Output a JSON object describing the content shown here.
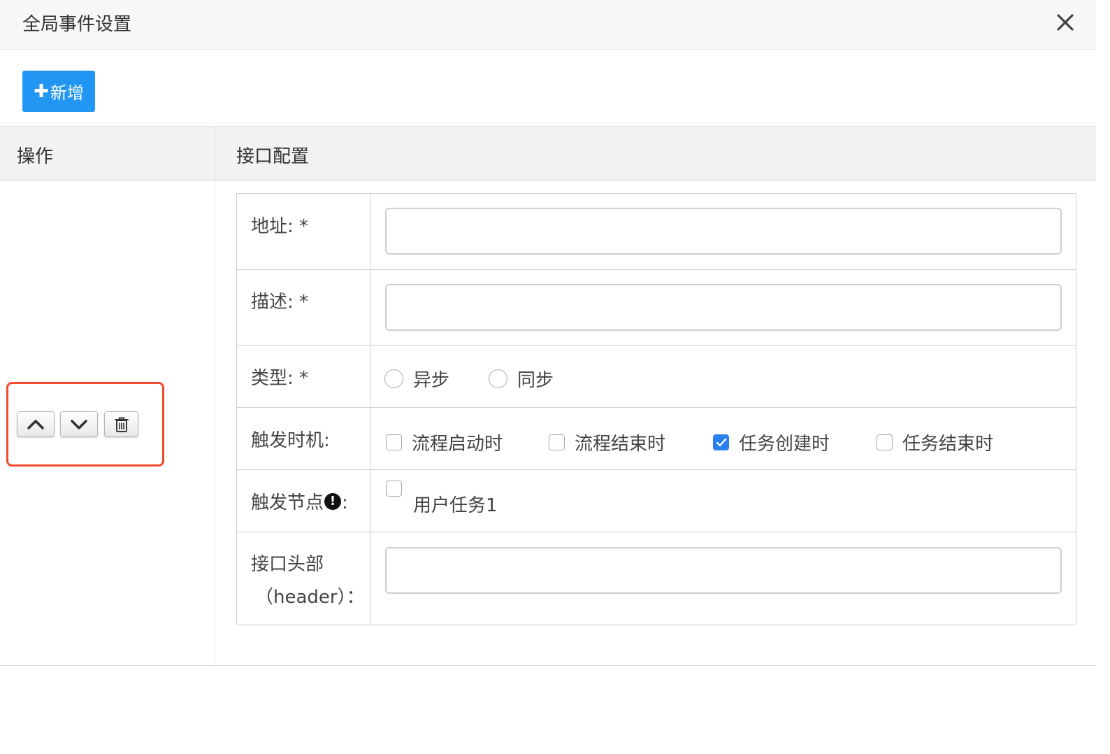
{
  "dialog": {
    "title": "全局事件设置",
    "close_icon": "close-icon"
  },
  "toolbar": {
    "add_plus": "✚",
    "add_label": "新增"
  },
  "grid": {
    "ops_header": "操作",
    "config_header": "接口配置"
  },
  "operations": {
    "up_icon": "chevron-up-icon",
    "down_icon": "chevron-down-icon",
    "delete_icon": "trash-icon"
  },
  "form": {
    "address": {
      "label": "地址: *",
      "value": ""
    },
    "description": {
      "label": "描述: *",
      "value": ""
    },
    "type": {
      "label": "类型: *",
      "options": [
        {
          "label": "异步",
          "selected": false
        },
        {
          "label": "同步",
          "selected": false
        }
      ]
    },
    "trigger_time": {
      "label": "触发时机:",
      "options": [
        {
          "label": "流程启动时",
          "checked": false
        },
        {
          "label": "流程结束时",
          "checked": false
        },
        {
          "label": "任务创建时",
          "checked": true
        },
        {
          "label": "任务结束时",
          "checked": false
        }
      ]
    },
    "trigger_node": {
      "label": "触发节点",
      "label_suffix": ":",
      "info_glyph": "!",
      "options": [
        {
          "label": "用户任务1",
          "checked": false
        }
      ]
    },
    "headers": {
      "label_line1": "接口头部",
      "label_line2": "（header）：",
      "value": ""
    }
  },
  "colors": {
    "primary": "#2196f3",
    "highlight": "#f24a2c",
    "checkbox_checked": "#2b80f0"
  }
}
